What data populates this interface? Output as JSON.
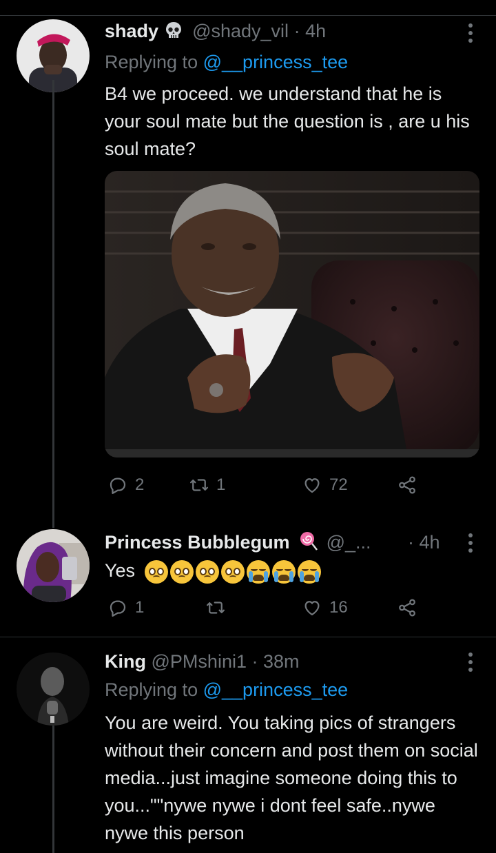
{
  "tweets": [
    {
      "name": "shady",
      "handle": "@shady_vil",
      "time": "· 4h",
      "replying_label": "Replying to",
      "replying_handle": "@__princess_tee",
      "body": "B4 we proceed. we understand  that he is your soul mate but the question is , are u his soul mate?",
      "replies": "2",
      "retweets": "1",
      "likes": "72"
    },
    {
      "name": "Princess Bubblegum",
      "handle": "@_...",
      "time": "· 4h",
      "body": "Yes",
      "replies": "1",
      "retweets": "",
      "likes": "16"
    },
    {
      "name": "King",
      "handle": "@PMshini1",
      "time": "· 38m",
      "replying_label": "Replying to",
      "replying_handle": "@__princess_tee",
      "body": "You are weird. You taking pics of strangers without their concern and post them on social media...just imagine someone doing this to you...\"\"nywe nywe i dont feel safe..nywe nywe this person"
    }
  ],
  "icons": [
    "skull-emoji",
    "lollipop-emoji",
    "pleading-face-emoji",
    "loudly-crying-face-emoji",
    "reply-icon",
    "retweet-icon",
    "like-icon",
    "share-icon",
    "more-icon"
  ],
  "colors": {
    "background": "#000000",
    "text": "#e7e9ea",
    "secondary": "#71767b",
    "link": "#1d9bf0",
    "divider": "#2f3336"
  }
}
